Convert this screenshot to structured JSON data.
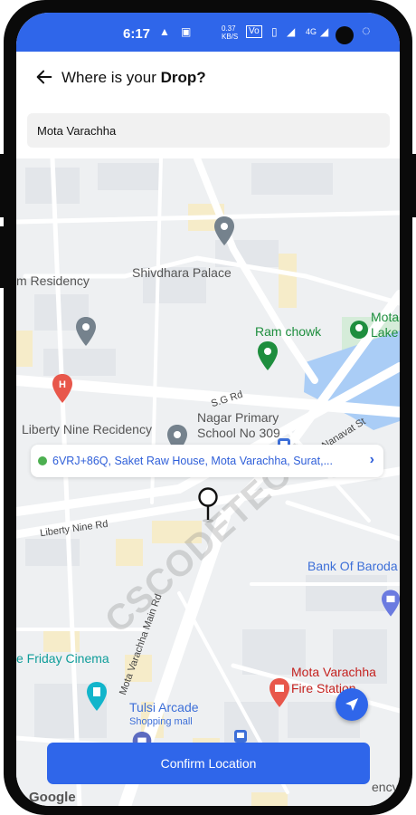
{
  "statusbar": {
    "time": "6:17",
    "net_speed": "0.37 KB/S",
    "network": "4G",
    "icons": [
      "drive-icon",
      "image-icon",
      "vibrate-icon",
      "wifi-icon",
      "signal-icon",
      "battery-icon"
    ]
  },
  "header": {
    "title_prefix": "Where is your",
    "title_bold": "Drop?"
  },
  "search": {
    "value": "Mota Varachha"
  },
  "map": {
    "places": [
      "m Residency",
      "Shivdhara Palace",
      "Ram chowk",
      "Mota",
      "Lake",
      "Liberty Nine Recidency",
      "Nagar Primary",
      "School No 309",
      "Bank Of Baroda",
      "e Friday Cinema",
      "Mota Varachha",
      "Fire Station",
      "Tulsi Arcade",
      "Shopping mall",
      "ency"
    ],
    "roads": [
      "S.G Rd",
      "Nanavat St",
      "Liberty Nine Rd",
      "Mota Varachha Main Rd"
    ]
  },
  "address_card": {
    "text": "6VRJ+86Q, Saket Raw House, Mota Varachha, Surat,..."
  },
  "confirm_label": "Confirm Location",
  "map_brand": "Google",
  "watermark": "CSCODETECH",
  "colors": {
    "primary": "#2f66ea",
    "green_dot": "#4caf50",
    "water": "#aacdf6"
  }
}
